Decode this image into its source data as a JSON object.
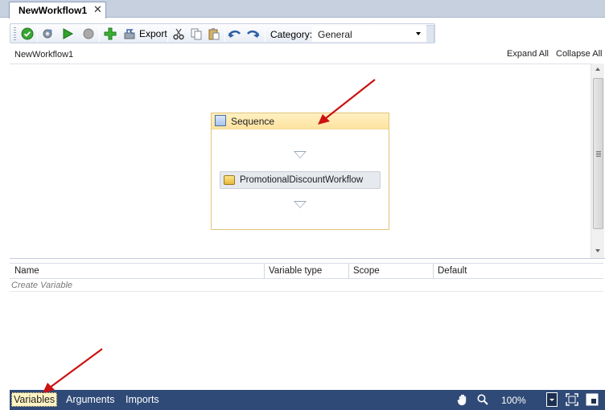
{
  "tab": {
    "title": "NewWorkflow1",
    "close_glyph": "✕"
  },
  "toolbar": {
    "export_label": "Export",
    "category_label": "Category:",
    "category_value": "General",
    "icons": [
      "check-circle-icon",
      "gear-icon",
      "run-icon",
      "stop-icon",
      "add-icon",
      "export-icon",
      "cut-icon",
      "copy-icon",
      "paste-icon",
      "undo-icon",
      "redo-icon"
    ]
  },
  "breadcrumb": {
    "path": "NewWorkflow1",
    "expand_all": "Expand All",
    "collapse_all": "Collapse All"
  },
  "designer": {
    "sequence_title": "Sequence",
    "activity_label": "PromotionalDiscountWorkflow"
  },
  "variables_grid": {
    "columns": [
      "Name",
      "Variable type",
      "Scope",
      "Default"
    ],
    "create_placeholder": "Create Variable"
  },
  "bottom_bar": {
    "tabs": [
      "Variables",
      "Arguments",
      "Imports"
    ],
    "zoom": "100%"
  },
  "colors": {
    "accent_bar": "#2f4a77",
    "annotation_arrow": "#cc1111",
    "sequence_header": "#fde3a0"
  }
}
